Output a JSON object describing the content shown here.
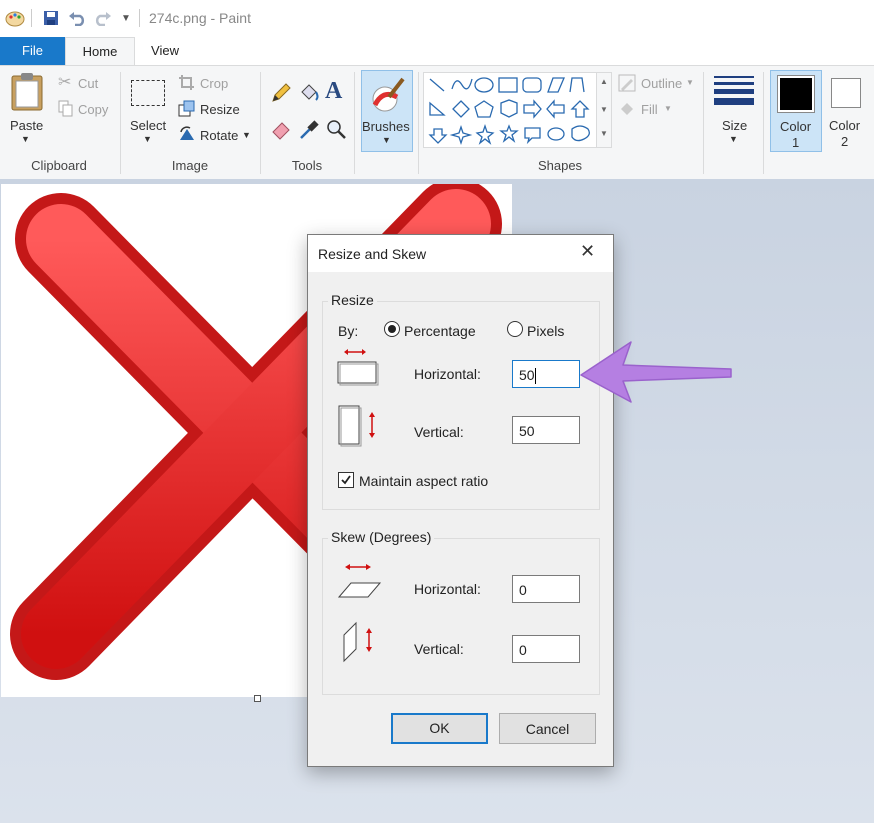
{
  "window": {
    "title": "274c.png - Paint"
  },
  "tabs": [
    "File",
    "Home",
    "View"
  ],
  "clipboard": {
    "paste": "Paste",
    "cut": "Cut",
    "copy": "Copy",
    "label": "Clipboard"
  },
  "image": {
    "select": "Select",
    "crop": "Crop",
    "resize": "Resize",
    "rotate": "Rotate",
    "label": "Image"
  },
  "tools": {
    "label": "Tools"
  },
  "brushes": {
    "label": "Brushes"
  },
  "shapes": {
    "outline": "Outline",
    "fill": "Fill",
    "label": "Shapes"
  },
  "size": {
    "label": "Size"
  },
  "colors": {
    "color1": "Color",
    "color1_num": "1",
    "color2": "Color",
    "color2_num": "2"
  },
  "dialog": {
    "title": "Resize and Skew",
    "resize_legend": "Resize",
    "by_label": "By:",
    "percentage": "Percentage",
    "pixels": "Pixels",
    "horizontal_label": "Horizontal:",
    "horizontal_value": "50",
    "vertical_label": "Vertical:",
    "vertical_value": "50",
    "maintain": "Maintain aspect ratio",
    "skew_legend": "Skew (Degrees)",
    "skew_h_label": "Horizontal:",
    "skew_h_value": "0",
    "skew_v_label": "Vertical:",
    "skew_v_value": "0",
    "ok": "OK",
    "cancel": "Cancel"
  },
  "accent_colors": {
    "ribbon_blue": "#1979ca",
    "arrow_purple": "#b57fe2",
    "x_red": "#e02020"
  }
}
